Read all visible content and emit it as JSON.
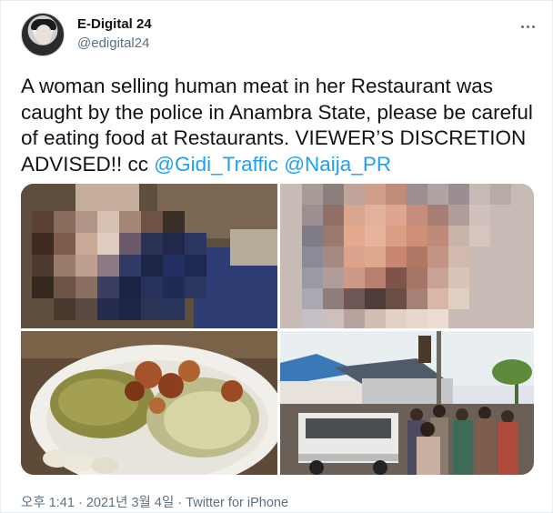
{
  "author": {
    "display_name": "E-Digital 24",
    "handle": "@edigital24"
  },
  "tweet": {
    "text_plain": "A woman selling human meat in her Restaurant was caught by the police in Anambra State, please be careful of eating food at Restaurants. VIEWER’S DISCRETION ADVISED!! cc ",
    "mention1": "@Gidi_Traffic",
    "separator": " ",
    "mention2": "@Naija_PR"
  },
  "meta": {
    "time": "오후 1:41",
    "dot1": " · ",
    "date": "2021년 3월 4일",
    "dot2": " · ",
    "source": "Twitter for iPhone"
  },
  "icons": {
    "more": "more-icon",
    "avatar": "avatar"
  },
  "colors": {
    "link": "#1da1f2",
    "secondary_text": "#5b7083",
    "primary_text": "#0f1419"
  }
}
